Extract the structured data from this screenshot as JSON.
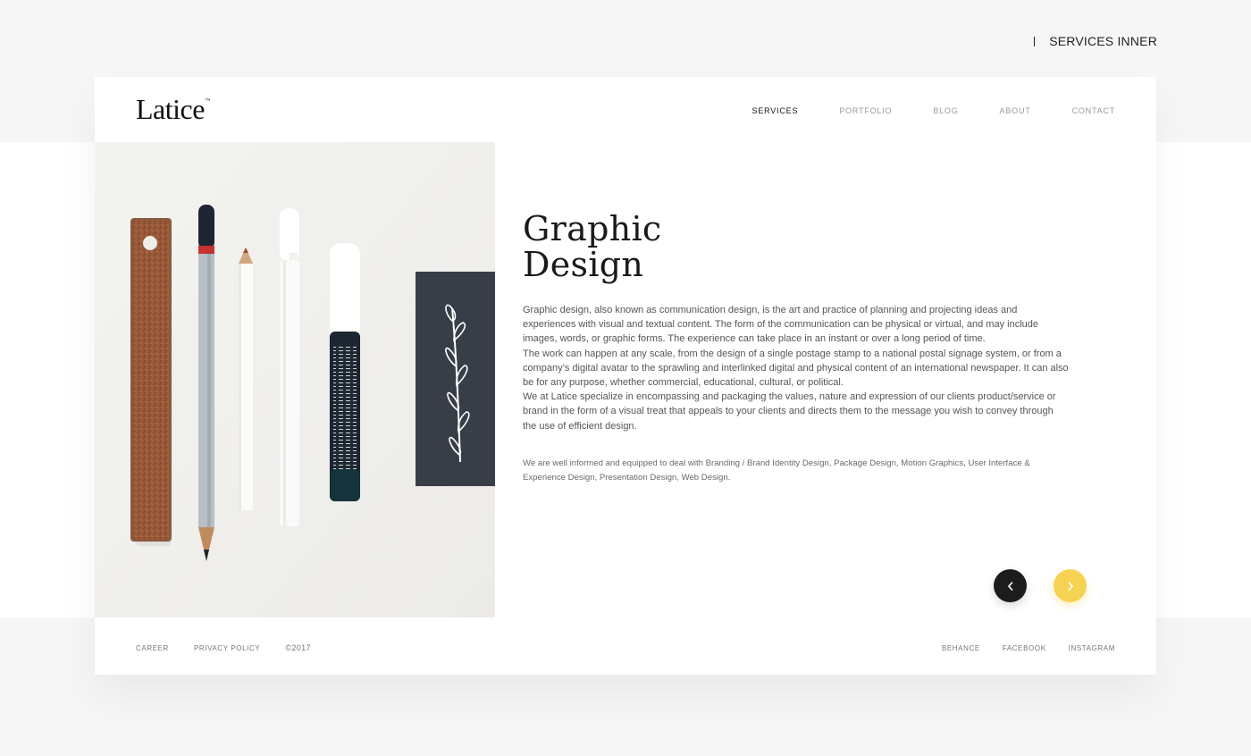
{
  "page_label": "SERVICES INNER",
  "header": {
    "logo_text": "Latice",
    "logo_mark": "™",
    "nav": [
      {
        "label": "SERVICES",
        "active": true
      },
      {
        "label": "PORTFOLIO",
        "active": false
      },
      {
        "label": "BLOG",
        "active": false
      },
      {
        "label": "ABOUT",
        "active": false
      },
      {
        "label": "CONTACT",
        "active": false
      }
    ]
  },
  "main": {
    "title_line1": "Graphic",
    "title_line2": "Design",
    "paragraphs": [
      "Graphic design, also known as communication design, is the art and practice of planning and projecting ideas and experiences with visual and textual content. The form of the communication can be physical or virtual, and may include images, words, or graphic forms. The experience can take place in an instant or over a long period of time.",
      "The work can happen at any scale, from the design of a single postage stamp to a national postal signage system, or from a company’s digital avatar to the sprawling and interlinked digital and physical content of an international newspaper. It can also be for any purpose, whether commercial, educational, cultural, or political.",
      "We at Latice specialize in encompassing and packaging the values, nature and expression of our clients product/service or brand in the form of a visual treat that appeals to your clients and directs them to the message you wish to convey through the use of efficient design."
    ],
    "services_text": "We are well informed and equipped to deal with Branding / Brand Identity Design, Package Design, Motion Graphics, User Interface & Experience Design, Presentation Design, Web Design.",
    "prev_icon": "chevron-left-icon",
    "next_icon": "chevron-right-icon"
  },
  "footer": {
    "career": "CAREER",
    "privacy": "PRIVACY POLICY",
    "copyright": "©2017",
    "behance": "BEHANCE",
    "facebook": "FACEBOOK",
    "instagram": "INSTAGRAM"
  },
  "colors": {
    "accent_yellow": "#f7d354",
    "dark_button": "#1c1c1c",
    "background": "#f6f6f6"
  }
}
